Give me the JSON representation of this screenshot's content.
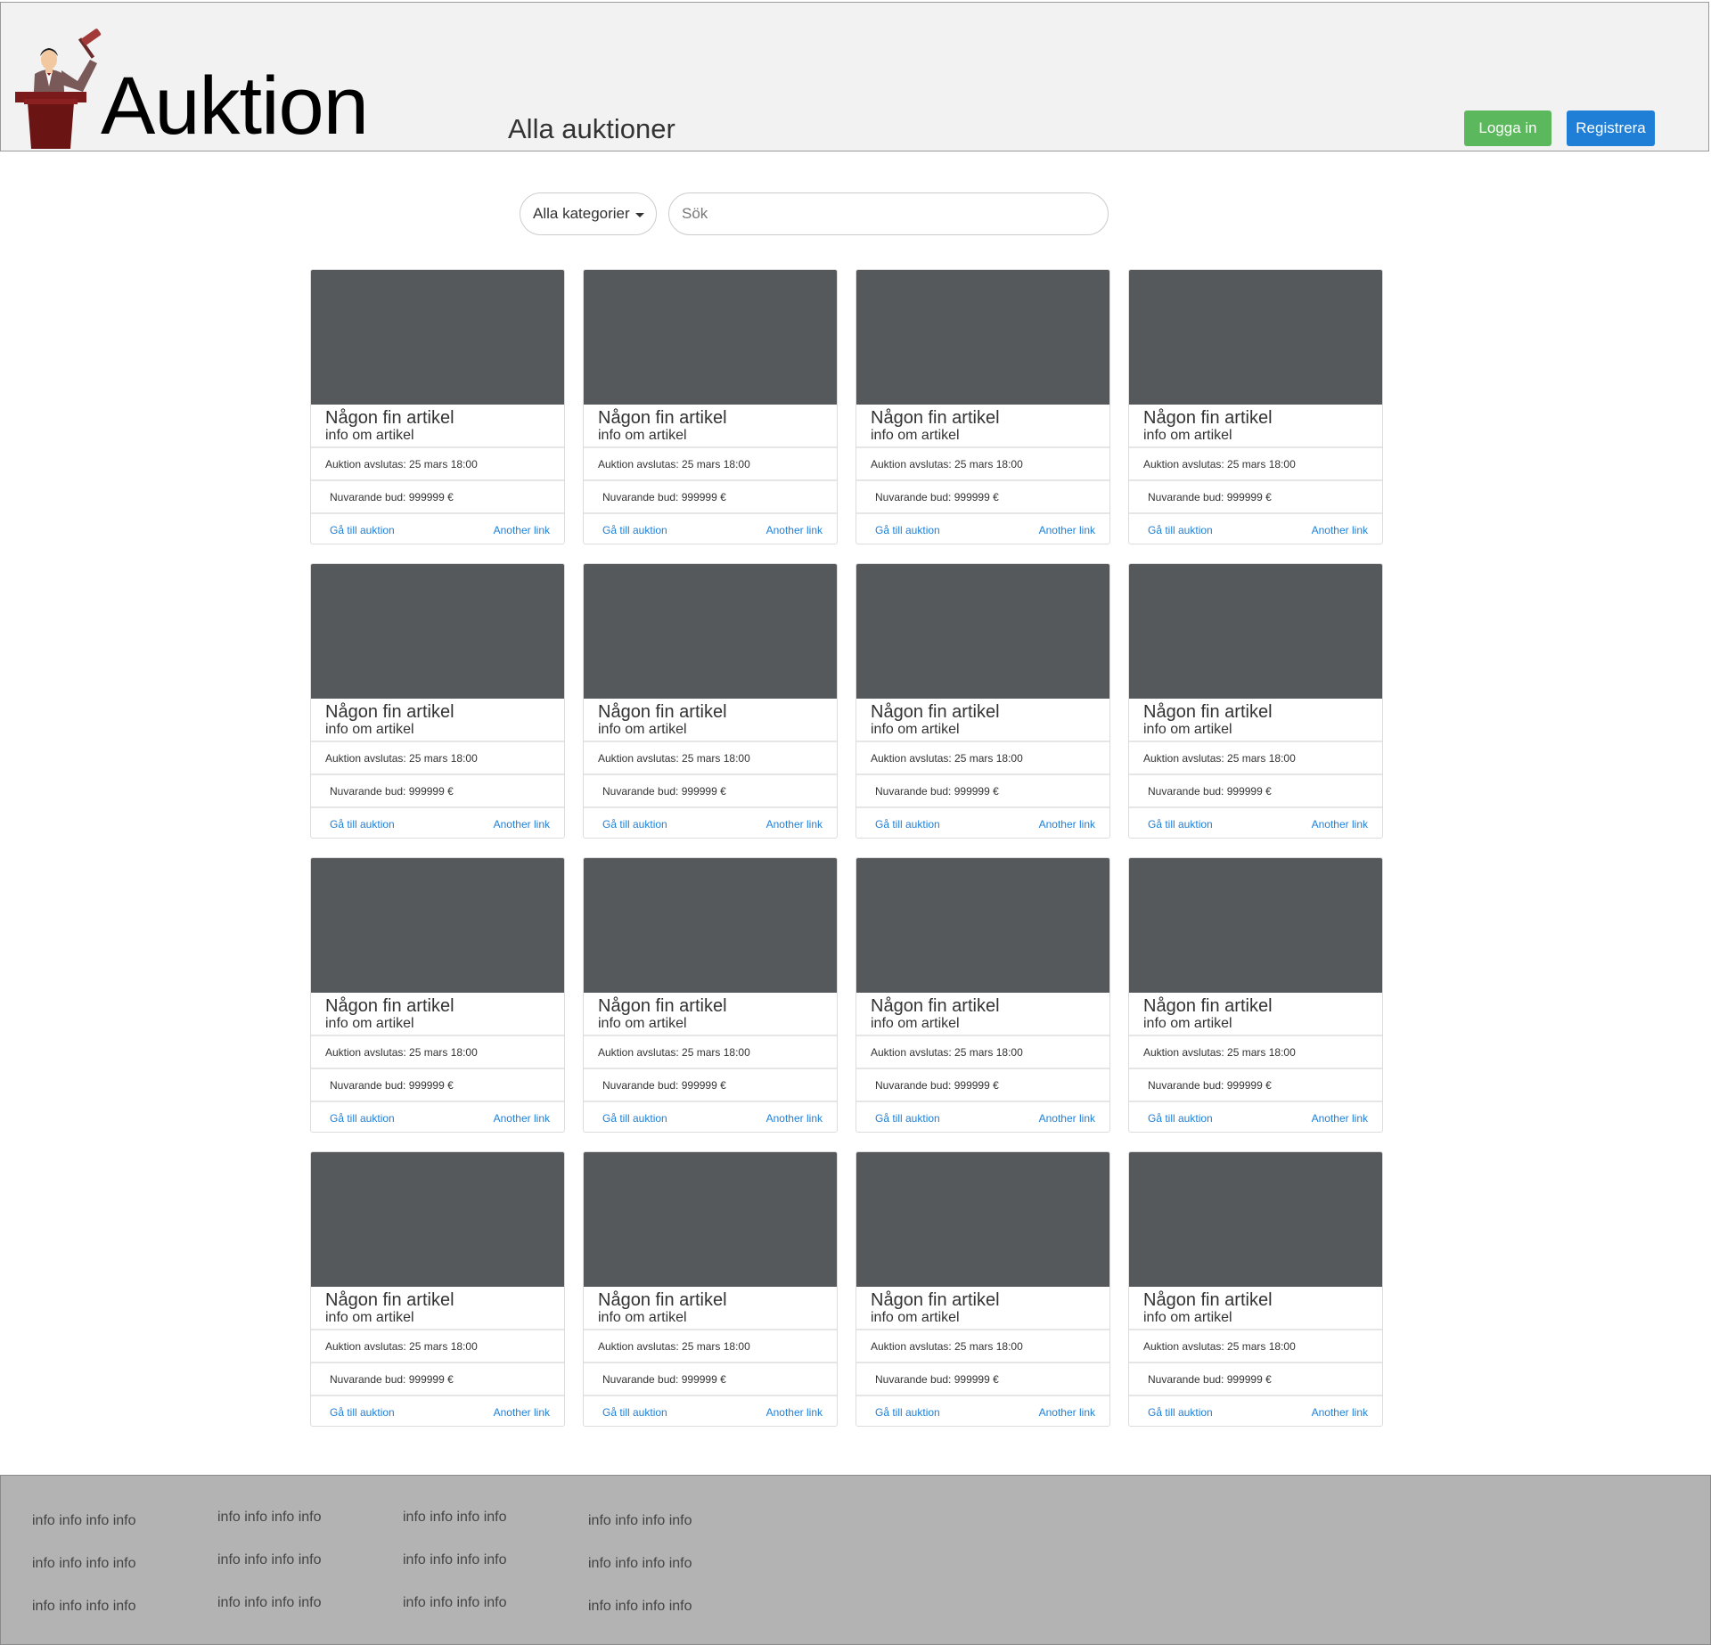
{
  "header": {
    "brand": "Auktion",
    "title": "Alla auktioner",
    "login_label": "Logga in",
    "register_label": "Registrera",
    "colors": {
      "login": "#5cb85c",
      "register": "#1f7fd6"
    }
  },
  "filters": {
    "category_selected": "Alla kategorier",
    "search_placeholder": "Sök"
  },
  "cards": [
    {
      "title": "Någon fin artikel",
      "subtitle": "info om artikel",
      "ends": "Auktion avslutas: 25 mars 18:00",
      "bid": "Nuvarande bud: 999999 €",
      "link1": "Gå till auktion",
      "link2": "Another link"
    },
    {
      "title": "Någon fin artikel",
      "subtitle": "info om artikel",
      "ends": "Auktion avslutas: 25 mars 18:00",
      "bid": "Nuvarande bud: 999999 €",
      "link1": "Gå till auktion",
      "link2": "Another link"
    },
    {
      "title": "Någon fin artikel",
      "subtitle": "info om artikel",
      "ends": "Auktion avslutas: 25 mars 18:00",
      "bid": "Nuvarande bud: 999999 €",
      "link1": "Gå till auktion",
      "link2": "Another link"
    },
    {
      "title": "Någon fin artikel",
      "subtitle": "info om artikel",
      "ends": "Auktion avslutas: 25 mars 18:00",
      "bid": "Nuvarande bud: 999999 €",
      "link1": "Gå till auktion",
      "link2": "Another link"
    },
    {
      "title": "Någon fin artikel",
      "subtitle": "info om artikel",
      "ends": "Auktion avslutas: 25 mars 18:00",
      "bid": "Nuvarande bud: 999999 €",
      "link1": "Gå till auktion",
      "link2": "Another link"
    },
    {
      "title": "Någon fin artikel",
      "subtitle": "info om artikel",
      "ends": "Auktion avslutas: 25 mars 18:00",
      "bid": "Nuvarande bud: 999999 €",
      "link1": "Gå till auktion",
      "link2": "Another link"
    },
    {
      "title": "Någon fin artikel",
      "subtitle": "info om artikel",
      "ends": "Auktion avslutas: 25 mars 18:00",
      "bid": "Nuvarande bud: 999999 €",
      "link1": "Gå till auktion",
      "link2": "Another link"
    },
    {
      "title": "Någon fin artikel",
      "subtitle": "info om artikel",
      "ends": "Auktion avslutas: 25 mars 18:00",
      "bid": "Nuvarande bud: 999999 €",
      "link1": "Gå till auktion",
      "link2": "Another link"
    },
    {
      "title": "Någon fin artikel",
      "subtitle": "info om artikel",
      "ends": "Auktion avslutas: 25 mars 18:00",
      "bid": "Nuvarande bud: 999999 €",
      "link1": "Gå till auktion",
      "link2": "Another link"
    },
    {
      "title": "Någon fin artikel",
      "subtitle": "info om artikel",
      "ends": "Auktion avslutas: 25 mars 18:00",
      "bid": "Nuvarande bud: 999999 €",
      "link1": "Gå till auktion",
      "link2": "Another link"
    },
    {
      "title": "Någon fin artikel",
      "subtitle": "info om artikel",
      "ends": "Auktion avslutas: 25 mars 18:00",
      "bid": "Nuvarande bud: 999999 €",
      "link1": "Gå till auktion",
      "link2": "Another link"
    },
    {
      "title": "Någon fin artikel",
      "subtitle": "info om artikel",
      "ends": "Auktion avslutas: 25 mars 18:00",
      "bid": "Nuvarande bud: 999999 €",
      "link1": "Gå till auktion",
      "link2": "Another link"
    },
    {
      "title": "Någon fin artikel",
      "subtitle": "info om artikel",
      "ends": "Auktion avslutas: 25 mars 18:00",
      "bid": "Nuvarande bud: 999999 €",
      "link1": "Gå till auktion",
      "link2": "Another link"
    },
    {
      "title": "Någon fin artikel",
      "subtitle": "info om artikel",
      "ends": "Auktion avslutas: 25 mars 18:00",
      "bid": "Nuvarande bud: 999999 €",
      "link1": "Gå till auktion",
      "link2": "Another link"
    },
    {
      "title": "Någon fin artikel",
      "subtitle": "info om artikel",
      "ends": "Auktion avslutas: 25 mars 18:00",
      "bid": "Nuvarande bud: 999999 €",
      "link1": "Gå till auktion",
      "link2": "Another link"
    },
    {
      "title": "Någon fin artikel",
      "subtitle": "info om artikel",
      "ends": "Auktion avslutas: 25 mars 18:00",
      "bid": "Nuvarande bud: 999999 €",
      "link1": "Gå till auktion",
      "link2": "Another link"
    }
  ],
  "footer": {
    "columns": [
      [
        "info info info info",
        "info info info info",
        "info info info info"
      ],
      [
        "info info info info",
        "info info info info",
        "info info info info"
      ],
      [
        "info info info info",
        "info info info info",
        "info info info info"
      ],
      [
        "info info info info",
        "info info info info",
        "info info info info"
      ]
    ]
  }
}
